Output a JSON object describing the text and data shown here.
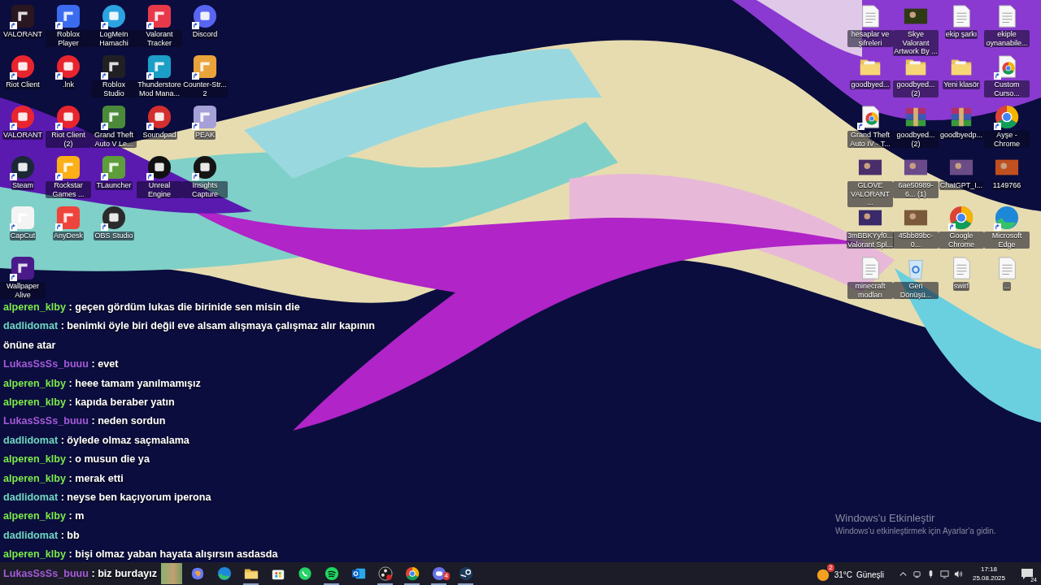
{
  "left_icon_rows": [
    [
      {
        "label": "VALORANT",
        "kind": "tile",
        "color": "#2a1620",
        "shortcut": true
      },
      {
        "label": "Roblox Player",
        "kind": "tile",
        "color": "#3b6cf0",
        "shortcut": true
      },
      {
        "label": "LogMeIn Hamachi",
        "kind": "round",
        "color": "#2ba3e0",
        "shortcut": true
      },
      {
        "label": "Valorant Tracker",
        "kind": "tile",
        "color": "#e8394a",
        "shortcut": true
      },
      {
        "label": "Discord",
        "kind": "round",
        "color": "#5865f2",
        "shortcut": true
      }
    ],
    [
      {
        "label": "Riot Client",
        "kind": "round",
        "color": "#e8252e",
        "shortcut": true
      },
      {
        "label": ".lnk",
        "kind": "round",
        "color": "#e8252e",
        "shortcut": true
      },
      {
        "label": "Roblox Studio",
        "kind": "tile",
        "color": "#202024",
        "shortcut": true
      },
      {
        "label": "Thunderstore Mod Mana...",
        "kind": "tile",
        "color": "#1b9fc6",
        "shortcut": true
      },
      {
        "label": "Counter-Str... 2",
        "kind": "tile",
        "color": "#e8a33a",
        "shortcut": true
      }
    ],
    [
      {
        "label": "VALORANT",
        "kind": "round",
        "color": "#e8252e",
        "shortcut": true
      },
      {
        "label": "Riot Client (2)",
        "kind": "round",
        "color": "#e8252e",
        "shortcut": true
      },
      {
        "label": "Grand Theft Auto V Le...",
        "kind": "tile",
        "color": "#4b8a3a",
        "shortcut": true
      },
      {
        "label": "Soundpad",
        "kind": "round",
        "color": "#d32f2f",
        "shortcut": true
      },
      {
        "label": "PEAK",
        "kind": "tile",
        "color": "#a6a0d8",
        "shortcut": true
      }
    ],
    [
      {
        "label": "Steam",
        "kind": "round",
        "color": "#1b2838",
        "shortcut": true
      },
      {
        "label": "Rockstar Games ...",
        "kind": "tile",
        "color": "#fcaf17",
        "shortcut": true
      },
      {
        "label": "TLauncher",
        "kind": "tile",
        "color": "#5d9e3a",
        "shortcut": true
      },
      {
        "label": "Unreal Engine",
        "kind": "round",
        "color": "#111111",
        "shortcut": true
      },
      {
        "label": "Insights Capture",
        "kind": "round",
        "color": "#151515",
        "shortcut": true
      }
    ],
    [
      {
        "label": "CapCut",
        "kind": "tile",
        "color": "#f4f4f4",
        "shortcut": true
      },
      {
        "label": "AnyDesk",
        "kind": "tile",
        "color": "#ef443b",
        "shortcut": true
      },
      {
        "label": "OBS Studio",
        "kind": "round",
        "color": "#2b2b2b",
        "shortcut": true
      }
    ],
    [
      {
        "label": "Wallpaper Alive",
        "kind": "tile",
        "color": "#4b1a8a",
        "shortcut": true
      }
    ]
  ],
  "right_icons": [
    {
      "label": "hesaplar ve şifreleri",
      "kind": "document",
      "shortcut": false
    },
    {
      "label": "Skye Valorant Artwork By ...",
      "kind": "image",
      "color": "#2e3a14",
      "shortcut": false
    },
    {
      "label": "ekip şarkı",
      "kind": "document",
      "shortcut": false
    },
    {
      "label": "ekiple oynanabile...",
      "kind": "document",
      "shortcut": false
    },
    {
      "label": "goodbyed...",
      "kind": "folder",
      "shortcut": false
    },
    {
      "label": "goodbyed... (2)",
      "kind": "folder",
      "shortcut": false
    },
    {
      "label": "Yeni klasör",
      "kind": "folder",
      "shortcut": false
    },
    {
      "label": "Custom Curso...",
      "kind": "chrome-doc",
      "shortcut": true
    },
    {
      "label": "Grand Theft Auto IV - T...",
      "kind": "chrome-doc",
      "shortcut": true
    },
    {
      "label": "goodbyed... (2)",
      "kind": "archive",
      "shortcut": false
    },
    {
      "label": "goodbyedp...",
      "kind": "archive",
      "shortcut": false
    },
    {
      "label": "Ayşe - Chrome",
      "kind": "browser",
      "shortcut": true
    },
    {
      "label": "GLOVE VALORANT ...",
      "kind": "image",
      "color": "#4a2e6a",
      "shortcut": false
    },
    {
      "label": "6ae50989-6... (1)",
      "kind": "image",
      "color": "#6a4a8a",
      "shortcut": false
    },
    {
      "label": "ChatGPT_I...",
      "kind": "image",
      "color": "#6b4c86",
      "shortcut": false
    },
    {
      "label": "1149766",
      "kind": "image",
      "color": "#c05020",
      "shortcut": false
    },
    {
      "label": "3mBBKYyf0... Valorant Spl...",
      "kind": "image",
      "color": "#3a2a6a",
      "shortcut": false
    },
    {
      "label": "45bb89bc-0...",
      "kind": "image",
      "color": "#7a5a3a",
      "shortcut": false
    },
    {
      "label": "Google Chrome",
      "kind": "browser",
      "shortcut": true
    },
    {
      "label": "Microsoft Edge",
      "kind": "edge",
      "shortcut": true
    },
    {
      "label": "minecraft modları",
      "kind": "document",
      "shortcut": false
    },
    {
      "label": "Geri Dönüşü...",
      "kind": "recycle",
      "shortcut": false
    },
    {
      "label": "swirf",
      "kind": "document",
      "shortcut": false
    },
    {
      "label": "...",
      "kind": "document",
      "shortcut": false
    }
  ],
  "chat_messages": [
    {
      "user": "alperen_klby",
      "color": "#7ce84a",
      "text": ": geçen gördüm lukas die birinide sen misin die"
    },
    {
      "user": "dadlidomat",
      "color": "#6fd6c0",
      "text": ": benimki öyle biri değil eve alsam alışmaya çalışmaz alır kapının önüne atar"
    },
    {
      "user": "LukasSsSs_buuu",
      "color": "#a45ad8",
      "text": ": evet"
    },
    {
      "user": "alperen_klby",
      "color": "#7ce84a",
      "text": ": heee tamam yanılmamışız"
    },
    {
      "user": "alperen_klby",
      "color": "#7ce84a",
      "text": ": kapıda beraber yatın"
    },
    {
      "user": "LukasSsSs_buuu",
      "color": "#a45ad8",
      "text": ": neden sordun"
    },
    {
      "user": "dadlidomat",
      "color": "#6fd6c0",
      "text": ": öylede olmaz saçmalama"
    },
    {
      "user": "alperen_klby",
      "color": "#7ce84a",
      "text": ": o musun die ya"
    },
    {
      "user": "alperen_klby",
      "color": "#7ce84a",
      "text": ": merak etti"
    },
    {
      "user": "dadlidomat",
      "color": "#6fd6c0",
      "text": ": neyse ben kaçıyorum iperona"
    },
    {
      "user": "alperen_klby",
      "color": "#7ce84a",
      "text": ": m"
    },
    {
      "user": "dadlidomat",
      "color": "#6fd6c0",
      "text": ": bb"
    },
    {
      "user": "alperen_klby",
      "color": "#7ce84a",
      "text": ": bişi olmaz yaban hayata alışırsın asdasda"
    },
    {
      "user": "LukasSsSs_buuu",
      "color": "#a45ad8",
      "text": ": biz burdayız"
    }
  ],
  "activation_notice": {
    "title": "Windows'u Etkinleştir",
    "text": "Windows'u etkinleştirmek için Ayarlar'a gidin."
  },
  "taskbar": {
    "apps": [
      {
        "kind": "copilot",
        "running": false
      },
      {
        "kind": "edge",
        "running": false
      },
      {
        "kind": "explorer",
        "running": true
      },
      {
        "kind": "store",
        "running": false
      },
      {
        "kind": "whatsapp",
        "running": false
      },
      {
        "kind": "spotify",
        "running": true
      },
      {
        "kind": "outlook",
        "running": false
      },
      {
        "kind": "obs",
        "running": true
      },
      {
        "kind": "chrome",
        "running": true
      },
      {
        "kind": "discord",
        "running": true,
        "badge": "4"
      },
      {
        "kind": "steam",
        "running": true
      }
    ],
    "weather": {
      "badge": "2",
      "temperature": "31°C",
      "condition": "Güneşli"
    },
    "time": "17:18",
    "date": "25.08.2025",
    "notification_count": "24"
  }
}
